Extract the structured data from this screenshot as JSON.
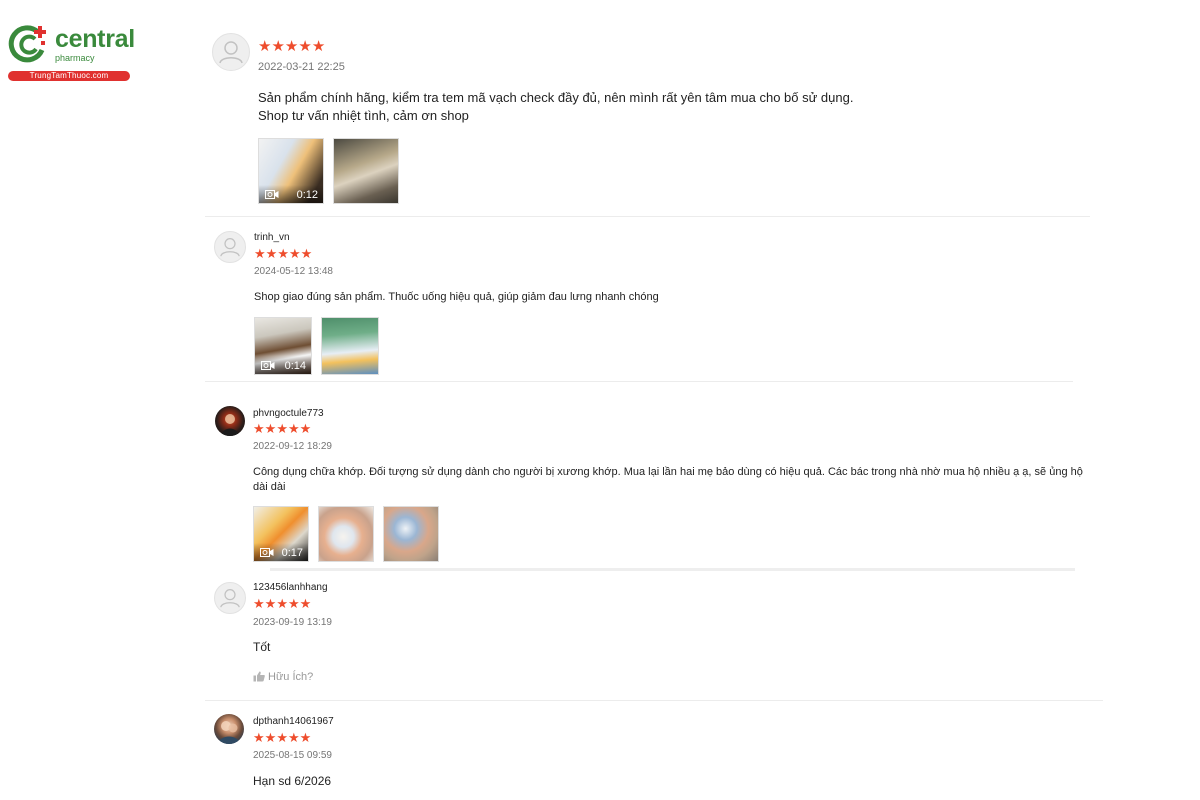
{
  "logo": {
    "word": "central",
    "sub": "pharmacy",
    "pill": "TrungTamThuoc.com",
    "colors": {
      "green": "#3a8a3c",
      "red": "#e0312f"
    }
  },
  "star_color": "#ee4d2d",
  "reviews": [
    {
      "username": "",
      "rating": 5,
      "stars": "★★★★★",
      "date": "2022-03-21 22:25",
      "content_lines": [
        "Sản phẩm chính hãng, kiểm tra tem mã vạch check đầy đủ, nên mình rất yên tâm mua cho bố sử dụng.",
        "Shop tư vấn nhiệt tình, cảm ơn shop"
      ],
      "media": [
        {
          "type": "video",
          "duration": "0:12"
        },
        {
          "type": "image"
        }
      ]
    },
    {
      "username": "trinh_vn",
      "rating": 5,
      "stars": "★★★★★",
      "date": "2024-05-12 13:48",
      "content_lines": [
        "Shop giao đúng sản phẩm. Thuốc uống hiệu quả, giúp giảm đau lưng nhanh chóng"
      ],
      "media": [
        {
          "type": "video",
          "duration": "0:14"
        },
        {
          "type": "image"
        }
      ]
    },
    {
      "username": "phvngoctule773",
      "rating": 5,
      "stars": "★★★★★",
      "date": "2022-09-12 18:29",
      "content_lines": [
        "Công dụng chữa khớp. Đối tượng sử dụng dành cho người bị xương khớp. Mua lại lần hai mẹ bảo dùng có hiệu quả. Các bác trong nhà nhờ mua hộ nhiều ạ ạ, sẽ ủng hộ",
        "dài dài"
      ],
      "media": [
        {
          "type": "video",
          "duration": "0:17"
        },
        {
          "type": "image"
        },
        {
          "type": "image"
        }
      ]
    },
    {
      "username": "123456lanhhang",
      "rating": 5,
      "stars": "★★★★★",
      "date": "2023-09-19 13:19",
      "content_lines": [
        "Tốt"
      ],
      "helpful": "Hữu Ích?"
    },
    {
      "username": "dpthanh14061967",
      "rating": 5,
      "stars": "★★★★★",
      "date": "2025-08-15 09:59",
      "content_lines": [
        "Hạn sd 6/2026"
      ]
    }
  ]
}
